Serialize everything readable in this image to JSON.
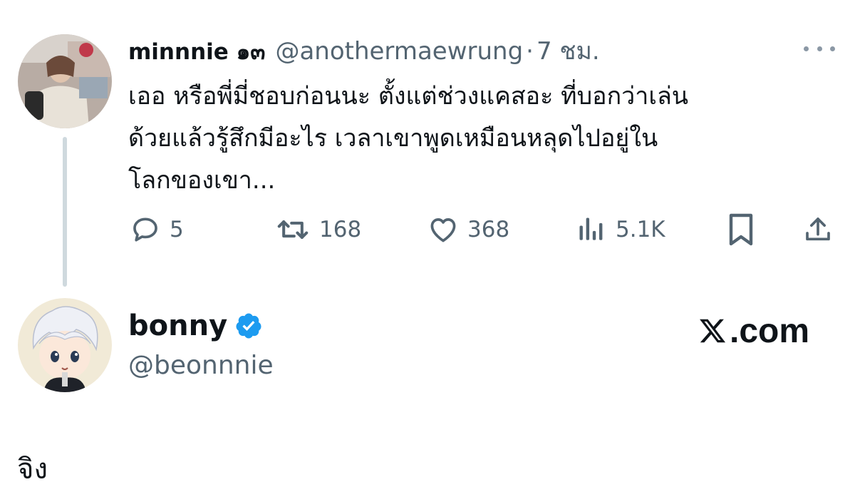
{
  "reply_tweet": {
    "display_name": "minnnie ๑๓",
    "handle": "@anothermaewrung",
    "separator": "·",
    "time": "7 ชม.",
    "text_lines": [
      "เออ หรือพี่มี่ชอบก่อนนะ ตั้งแต่ช่วงแคสอะ ที่บอกว่าเล่น",
      "ด้วยแล้วรู้สึกมีอะไร เวลาเขาพูดเหมือนหลุดไปอยู่ใน",
      "โลกของเขา..."
    ],
    "actions": {
      "replies": "5",
      "retweets": "168",
      "likes": "368",
      "views": "5.1K"
    },
    "more_icon": "ellipsis-icon"
  },
  "main_tweet": {
    "display_name": "bonny",
    "handle": "@beonnnie",
    "verified": true,
    "text": "จิง"
  },
  "brand": {
    "text": ".com"
  },
  "colors": {
    "text_primary": "#0f1419",
    "text_secondary": "#536471",
    "verified_blue": "#1d9bf0",
    "thread_line": "#cfd9de",
    "background": "#ffffff"
  }
}
